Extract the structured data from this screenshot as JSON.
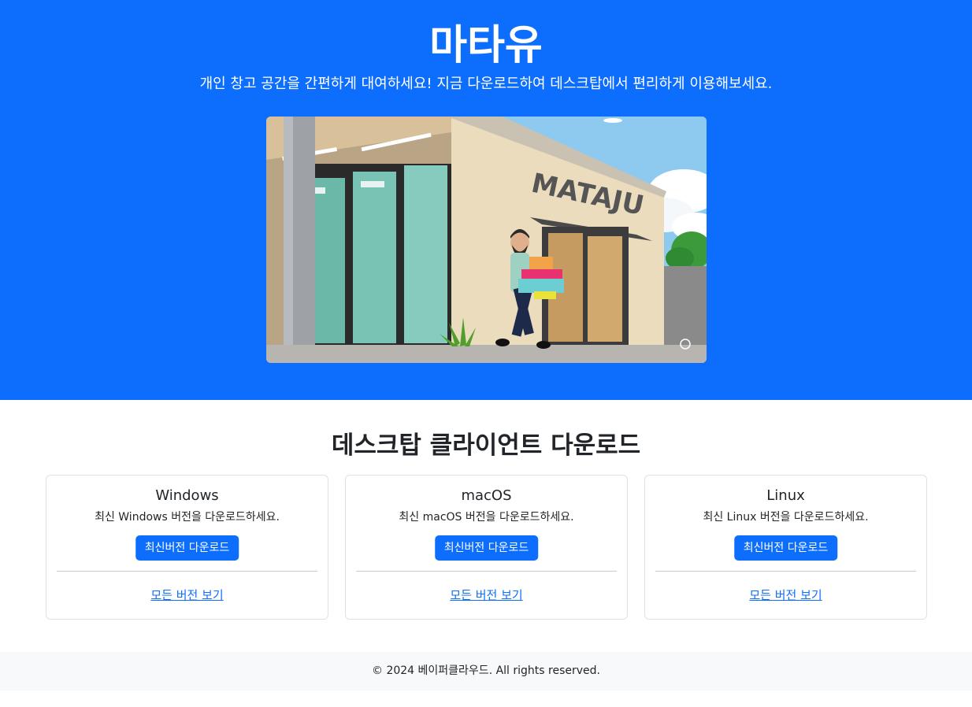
{
  "hero": {
    "title": "마타유",
    "subtitle": "개인 창고 공간을 간편하게 대여하세요! 지금 다운로드하여 데스크탑에서 편리하게 이용해보세요.",
    "image": {
      "sign_text": "MATAJU"
    }
  },
  "downloads": {
    "title": "데스크탑 클라이언트 다운로드",
    "cards": [
      {
        "title": "Windows",
        "text": "최신 Windows 버전을 다운로드하세요.",
        "button": "최신버전 다운로드",
        "link": "모든 버전 보기"
      },
      {
        "title": "macOS",
        "text": "최신 macOS 버전을 다운로드하세요.",
        "button": "최신버전 다운로드",
        "link": "모든 버전 보기"
      },
      {
        "title": "Linux",
        "text": "최신 Linux 버전을 다운로드하세요.",
        "button": "최신버전 다운로드",
        "link": "모든 버전 보기"
      }
    ]
  },
  "footer": {
    "text": "© 2024 베이퍼클라우드. All rights reserved."
  },
  "colors": {
    "primary": "#0d6efd",
    "footer_bg": "#f8f9fa",
    "card_border": "#dee2e6"
  }
}
